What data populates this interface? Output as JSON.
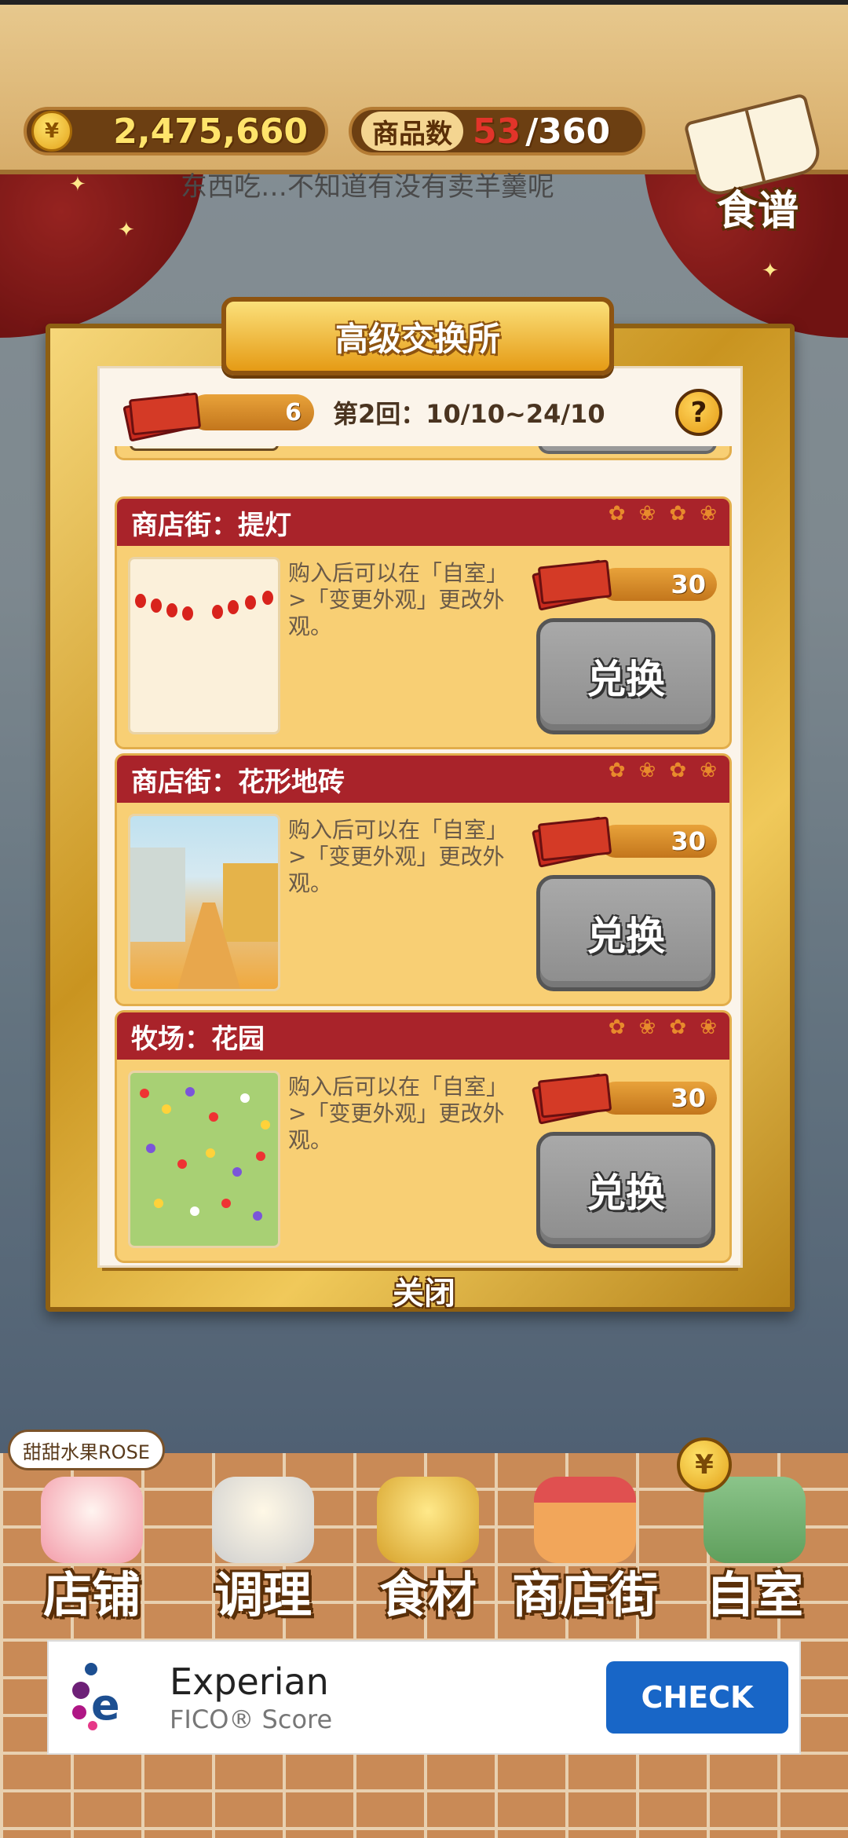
{
  "topbar": {
    "coins": "2,475,660",
    "goods_label": "商品数",
    "goods_count": "53",
    "goods_total": "/360",
    "recipe_label": "食谱",
    "ticker": "东西吃…不知道有没有卖羊羹呢"
  },
  "modal": {
    "title": "高级交换所",
    "tickets_owned": "6",
    "round": "第2回：10/10~24/10",
    "help_label": "?",
    "close_label": "关闭",
    "exchange_label": "兑换",
    "items": [
      {
        "name": "商店街：提灯",
        "desc": "购入后可以在「自室」>「变更外观」更改外观。",
        "price": "30",
        "image": "lantern-image"
      },
      {
        "name": "商店街：花形地砖",
        "desc": "购入后可以在「自室」>「变更外观」更改外观。",
        "price": "30",
        "image": "street-image"
      },
      {
        "name": "牧场：花园",
        "desc": "购入后可以在「自室」>「变更外观」更改外观。",
        "price": "30",
        "image": "garden-image"
      }
    ]
  },
  "nav": {
    "shop_name": "甜甜水果ROSE",
    "items": [
      {
        "label": "店铺",
        "icon": "cake-icon"
      },
      {
        "label": "调理",
        "icon": "mixing-bowl-icon"
      },
      {
        "label": "食材",
        "icon": "flour-bag-icon"
      },
      {
        "label": "商店街",
        "icon": "storefront-icon"
      },
      {
        "label": "自室",
        "icon": "staff-door-icon"
      }
    ],
    "home_badge": "¥"
  },
  "ad": {
    "title": "Experian",
    "subtitle": "FICO® Score",
    "cta": "CHECK"
  },
  "colors": {
    "accent_red": "#a9232a",
    "card_yellow": "#f8cf74",
    "button_gray": "#9a9a9a",
    "ad_blue": "#1866c7"
  }
}
